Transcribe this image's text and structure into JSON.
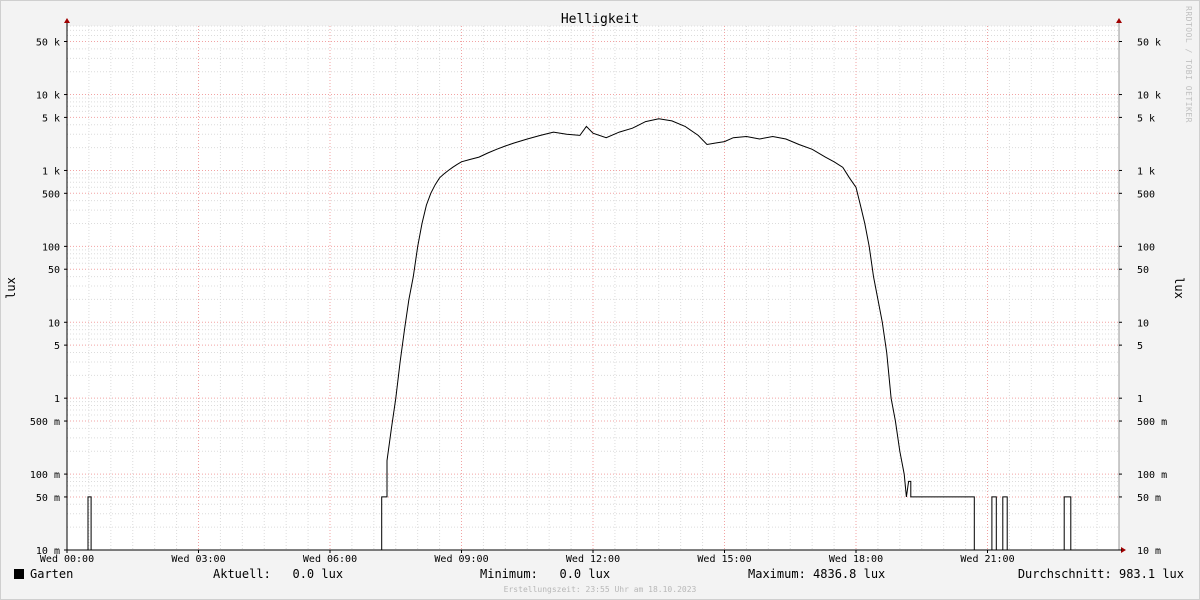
{
  "chart_data": {
    "type": "line",
    "title": "Helligkeit",
    "ylabel": "lux",
    "yscale": "log",
    "ylim": [
      0.01,
      80000
    ],
    "xlim": [
      0,
      24
    ],
    "x_tick_labels": [
      {
        "x": 0,
        "label": "Wed 00:00"
      },
      {
        "x": 3,
        "label": "Wed 03:00"
      },
      {
        "x": 6,
        "label": "Wed 06:00"
      },
      {
        "x": 9,
        "label": "Wed 09:00"
      },
      {
        "x": 12,
        "label": "Wed 12:00"
      },
      {
        "x": 15,
        "label": "Wed 15:00"
      },
      {
        "x": 18,
        "label": "Wed 18:00"
      },
      {
        "x": 21,
        "label": "Wed 21:00"
      }
    ],
    "y_tick_labels": [
      {
        "y": 0.01,
        "label": "10 m"
      },
      {
        "y": 0.05,
        "label": "50 m"
      },
      {
        "y": 0.1,
        "label": "100 m"
      },
      {
        "y": 0.5,
        "label": "500 m"
      },
      {
        "y": 1,
        "label": "1"
      },
      {
        "y": 5,
        "label": "5"
      },
      {
        "y": 10,
        "label": "10"
      },
      {
        "y": 50,
        "label": "50"
      },
      {
        "y": 100,
        "label": "100"
      },
      {
        "y": 500,
        "label": "500"
      },
      {
        "y": 1000,
        "label": "1 k"
      },
      {
        "y": 5000,
        "label": "5 k"
      },
      {
        "y": 10000,
        "label": "10 k"
      },
      {
        "y": 50000,
        "label": "50 k"
      }
    ],
    "grid": true,
    "series": [
      {
        "name": "Garten",
        "color": "#000000",
        "x": [
          0,
          0.48,
          0.48,
          0.55,
          0.55,
          7.18,
          7.18,
          7.3,
          7.3,
          7.4,
          7.5,
          7.6,
          7.7,
          7.8,
          7.9,
          8.0,
          8.1,
          8.2,
          8.3,
          8.4,
          8.5,
          8.6,
          8.7,
          8.8,
          8.9,
          9.0,
          9.2,
          9.4,
          9.6,
          9.8,
          10.0,
          10.2,
          10.5,
          10.8,
          11.1,
          11.4,
          11.7,
          11.85,
          12.0,
          12.3,
          12.6,
          12.9,
          13.2,
          13.5,
          13.8,
          14.1,
          14.4,
          14.6,
          14.8,
          15.0,
          15.2,
          15.5,
          15.8,
          16.1,
          16.4,
          16.7,
          17.0,
          17.3,
          17.5,
          17.7,
          17.85,
          18.0,
          18.1,
          18.2,
          18.3,
          18.4,
          18.5,
          18.6,
          18.7,
          18.8,
          18.9,
          19.0,
          19.1,
          19.15,
          19.15,
          19.2,
          19.25,
          19.25,
          19.4,
          19.4,
          20.7,
          20.7,
          21.1,
          21.1,
          21.2,
          21.2,
          21.35,
          21.35,
          21.45,
          21.45,
          22.75,
          22.75,
          22.9,
          22.9,
          24
        ],
        "y": [
          0.01,
          0.01,
          0.05,
          0.05,
          0.01,
          0.01,
          0.05,
          0.05,
          0.15,
          0.4,
          1,
          3,
          8,
          20,
          40,
          100,
          200,
          350,
          500,
          650,
          800,
          900,
          1000,
          1100,
          1200,
          1300,
          1400,
          1500,
          1700,
          1900,
          2100,
          2300,
          2600,
          2900,
          3200,
          3000,
          2900,
          3800,
          3100,
          2700,
          3200,
          3600,
          4400,
          4800,
          4500,
          3800,
          2900,
          2200,
          2300,
          2400,
          2700,
          2800,
          2600,
          2800,
          2600,
          2200,
          1900,
          1500,
          1300,
          1100,
          800,
          600,
          350,
          200,
          100,
          40,
          20,
          10,
          4,
          1,
          0.5,
          0.2,
          0.1,
          0.05,
          0.05,
          0.08,
          0.08,
          0.05,
          0.05,
          0.05,
          0.05,
          0.01,
          0.01,
          0.05,
          0.05,
          0.01,
          0.01,
          0.05,
          0.05,
          0.01,
          0.01,
          0.05,
          0.05,
          0.01,
          0.01
        ]
      }
    ]
  },
  "legend": {
    "series_name": "Garten",
    "current": "Aktuell:   0.0 lux",
    "minimum": "Minimum:   0.0 lux",
    "maximum": "Maximum: 4836.8 lux",
    "average": "Durchschnitt: 983.1 lux"
  },
  "watermark": "RRDTOOL / TOBI OETIKER",
  "footer": "Erstellungszeit: 23:55 Uhr am 18.10.2023"
}
